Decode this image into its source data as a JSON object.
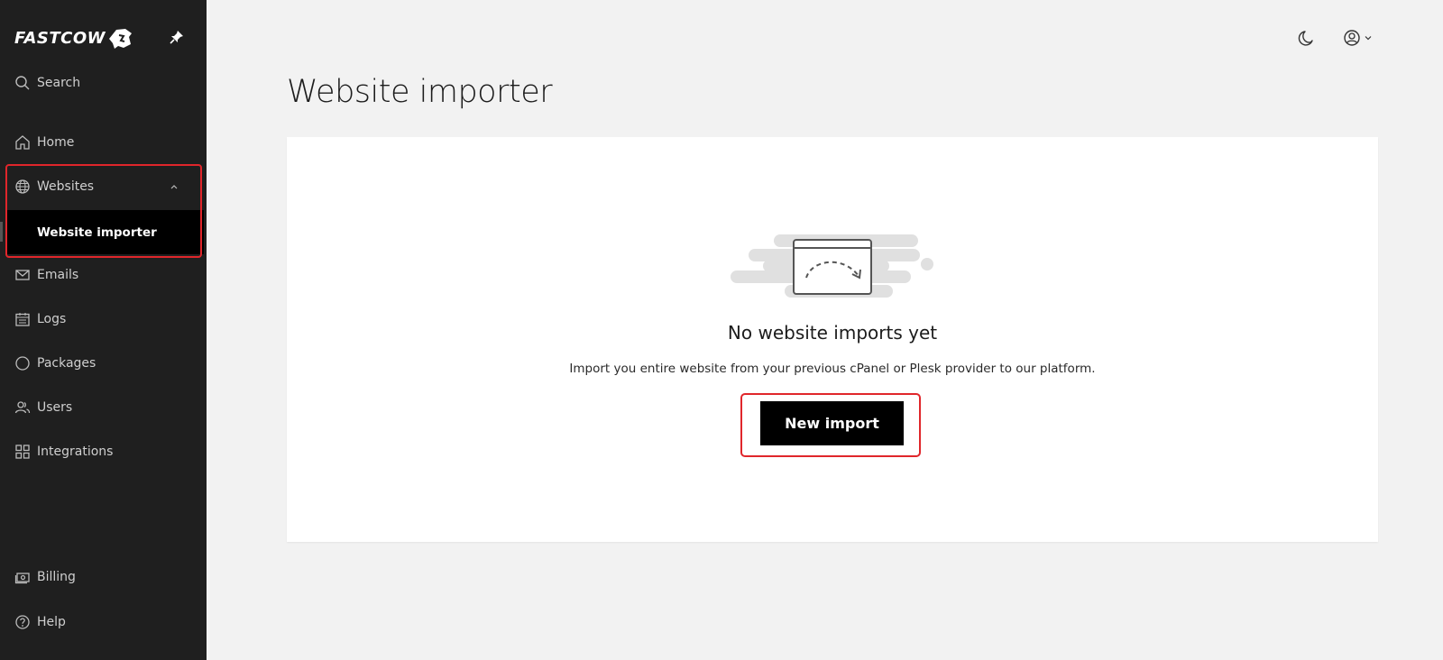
{
  "brand": {
    "name": "FASTCOW"
  },
  "sidebar": {
    "search_label": "Search",
    "items": [
      {
        "label": "Home",
        "icon": "home-icon"
      },
      {
        "label": "Websites",
        "icon": "globe-icon"
      },
      {
        "label": "Emails",
        "icon": "mail-icon"
      },
      {
        "label": "Logs",
        "icon": "calendar-icon"
      },
      {
        "label": "Packages",
        "icon": "circle-icon"
      },
      {
        "label": "Users",
        "icon": "users-icon"
      },
      {
        "label": "Integrations",
        "icon": "grid-icon"
      },
      {
        "label": "Billing",
        "icon": "billing-icon"
      },
      {
        "label": "Help",
        "icon": "help-icon"
      }
    ],
    "sub_items": [
      {
        "label": "Website importer"
      }
    ]
  },
  "page": {
    "title": "Website importer"
  },
  "empty_state": {
    "title": "No website imports yet",
    "description": "Import you entire website from your previous cPanel or Plesk provider to our platform.",
    "button_label": "New import"
  },
  "colors": {
    "sidebar_bg": "#1f1f1f",
    "active_bg": "#000000",
    "highlight": "#e0262b",
    "page_bg": "#f2f2f2"
  }
}
